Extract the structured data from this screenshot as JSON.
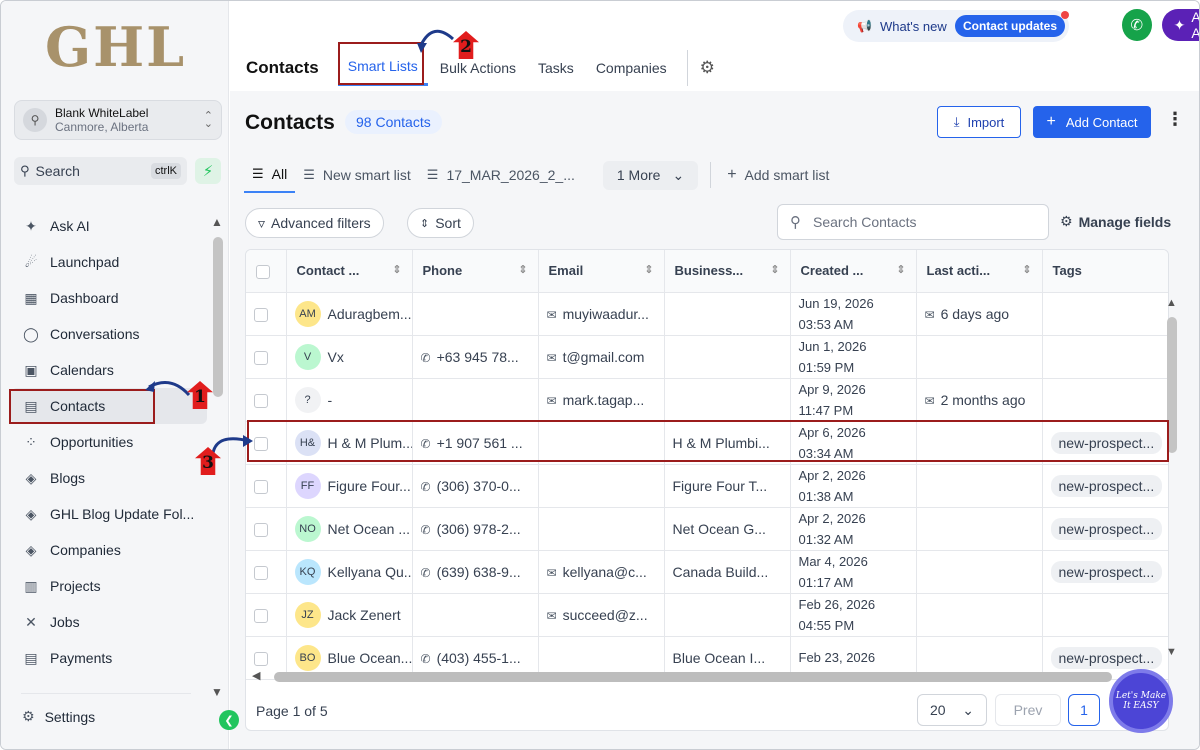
{
  "logo_text": "GHL",
  "location": {
    "name": "Blank WhiteLabel",
    "address": "Canmore, Alberta"
  },
  "sidebar_search": {
    "label": "Search",
    "shortcut": "ctrlK"
  },
  "nav": [
    {
      "label": "Ask AI",
      "icon": "sparkle-icon"
    },
    {
      "label": "Launchpad",
      "icon": "rocket-icon"
    },
    {
      "label": "Dashboard",
      "icon": "grid-icon"
    },
    {
      "label": "Conversations",
      "icon": "chat-icon"
    },
    {
      "label": "Calendars",
      "icon": "calendar-icon"
    },
    {
      "label": "Contacts",
      "icon": "contact-book-icon"
    },
    {
      "label": "Opportunities",
      "icon": "funnel-icon"
    },
    {
      "label": "Blogs",
      "icon": "cube-icon"
    },
    {
      "label": "GHL Blog Update Fol...",
      "icon": "cube-icon"
    },
    {
      "label": "Companies",
      "icon": "cube-icon"
    },
    {
      "label": "Projects",
      "icon": "chart-icon"
    },
    {
      "label": "Jobs",
      "icon": "tools-icon"
    },
    {
      "label": "Payments",
      "icon": "receipt-icon"
    }
  ],
  "settings_label": "Settings",
  "whats_new": {
    "label": "What's new",
    "pill": "Contact updates"
  },
  "ask_ai": "Ask AI",
  "header": {
    "title": "Contacts",
    "tabs": [
      "Smart Lists",
      "Bulk Actions",
      "Tasks",
      "Companies"
    ]
  },
  "page": {
    "title": "Contacts",
    "count": "98 Contacts",
    "import": "Import",
    "add": "Add Contact"
  },
  "views": {
    "all": "All",
    "v1": "New smart list",
    "v2": "17_MAR_2026_2_...",
    "more": "1 More",
    "add": "Add smart list"
  },
  "filters": {
    "advanced": "Advanced filters",
    "sort": "Sort",
    "search_placeholder": "Search Contacts",
    "manage": "Manage fields"
  },
  "columns": [
    "Contact ...",
    "Phone",
    "Email",
    "Business...",
    "Created ...",
    "Last acti...",
    "Tags"
  ],
  "rows": [
    {
      "initials": "AM",
      "color": "#fde68a",
      "name": "Aduragbem...",
      "phone": "",
      "email": "muyiwaadur...",
      "business": "",
      "created_date": "Jun 19, 2026",
      "created_time": "03:53 AM",
      "last": "6 days ago",
      "tag": ""
    },
    {
      "initials": "V",
      "color": "#bbf7d0",
      "name": "Vx",
      "phone": "+63 945 78...",
      "email": "t@gmail.com",
      "business": "",
      "created_date": "Jun 1, 2026",
      "created_time": "01:59 PM",
      "last": "",
      "tag": ""
    },
    {
      "initials": "?",
      "color": "#f1f2f4",
      "name": "-",
      "phone": "",
      "email": "mark.tagap...",
      "business": "",
      "created_date": "Apr 9, 2026",
      "created_time": "11:47 PM",
      "last": "2 months ago",
      "tag": ""
    },
    {
      "initials": "H&",
      "color": "#dbe1f5",
      "name": "H & M Plum...",
      "phone": "+1 907 561 ...",
      "email": "",
      "business": "H & M Plumbi...",
      "created_date": "Apr 6, 2026",
      "created_time": "03:34 AM",
      "last": "",
      "tag": "new-prospect..."
    },
    {
      "initials": "FF",
      "color": "#ddd6fe",
      "name": "Figure Four...",
      "phone": "(306) 370-0...",
      "email": "",
      "business": "Figure Four T...",
      "created_date": "Apr 2, 2026",
      "created_time": "01:38 AM",
      "last": "",
      "tag": "new-prospect..."
    },
    {
      "initials": "NO",
      "color": "#bbf7d0",
      "name": "Net Ocean ...",
      "phone": "(306) 978-2...",
      "email": "",
      "business": "Net Ocean G...",
      "created_date": "Apr 2, 2026",
      "created_time": "01:32 AM",
      "last": "",
      "tag": "new-prospect..."
    },
    {
      "initials": "KQ",
      "color": "#bae6fd",
      "name": "Kellyana Qu...",
      "phone": "(639) 638-9...",
      "email": "kellyana@c...",
      "business": "Canada Build...",
      "created_date": "Mar 4, 2026",
      "created_time": "01:17 AM",
      "last": "",
      "tag": "new-prospect..."
    },
    {
      "initials": "JZ",
      "color": "#fde68a",
      "name": "Jack Zenert",
      "phone": "",
      "email": "succeed@z...",
      "business": "",
      "created_date": "Feb 26, 2026",
      "created_time": "04:55 PM",
      "last": "",
      "tag": ""
    },
    {
      "initials": "BO",
      "color": "#fde68a",
      "name": "Blue Ocean...",
      "phone": "(403) 455-1...",
      "email": "",
      "business": "Blue Ocean I...",
      "created_date": "Feb 23, 2026",
      "created_time": "",
      "last": "",
      "tag": "new-prospect..."
    }
  ],
  "pager": {
    "label": "Page 1 of 5",
    "size": "20",
    "prev": "Prev",
    "page": "1"
  },
  "fab_text": "Let's Make It EASY",
  "annotations": [
    "1",
    "2",
    "3"
  ],
  "colors": {
    "accent": "#2563eb",
    "annotation": "#9b1c1c",
    "ai_purple": "#5b21b6"
  }
}
